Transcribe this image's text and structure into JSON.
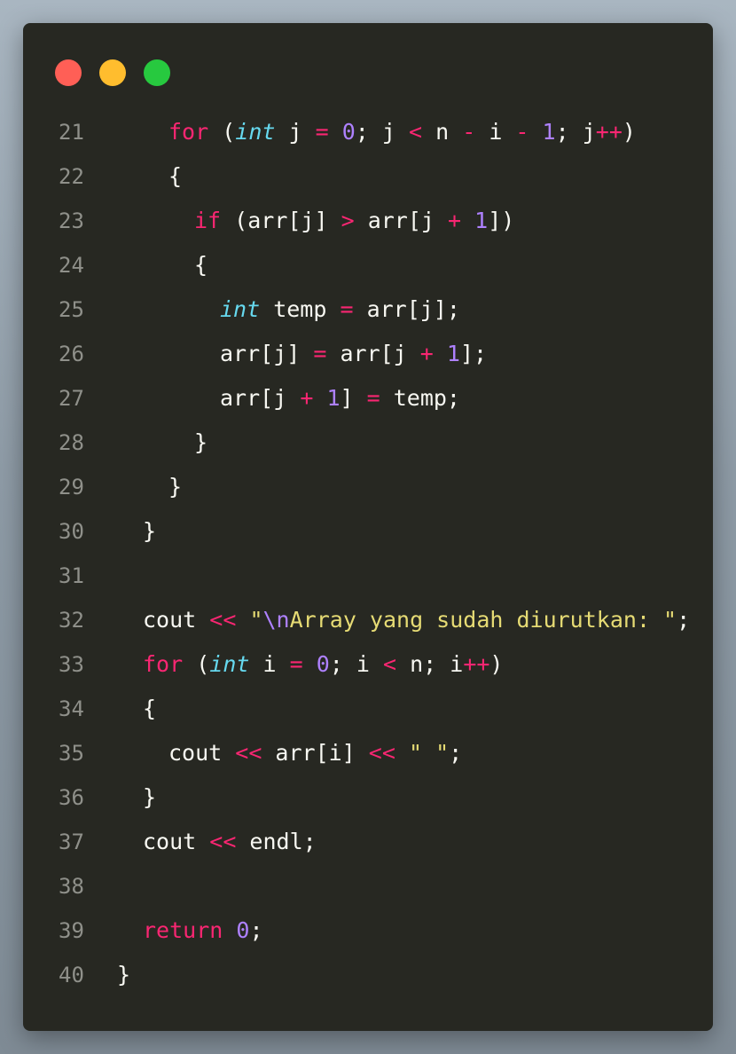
{
  "window": {
    "controls": [
      {
        "name": "close",
        "color": "#ff5f56"
      },
      {
        "name": "minimize",
        "color": "#ffbd2e"
      },
      {
        "name": "maximize",
        "color": "#27c93f"
      }
    ]
  },
  "colors": {
    "background": "#272822",
    "keyword": "#f92672",
    "type": "#66d9ef",
    "number": "#ae81ff",
    "string": "#e6db74",
    "plain": "#f8f8f2",
    "line_number": "#8f908a"
  },
  "code": {
    "lines": [
      {
        "n": "21",
        "indent": 2,
        "tokens": [
          [
            "kw",
            "for"
          ],
          [
            "plain",
            " ("
          ],
          [
            "type",
            "int"
          ],
          [
            "plain",
            " j "
          ],
          [
            "op",
            "="
          ],
          [
            "plain",
            " "
          ],
          [
            "num",
            "0"
          ],
          [
            "plain",
            "; j "
          ],
          [
            "op",
            "<"
          ],
          [
            "plain",
            " n "
          ],
          [
            "op",
            "-"
          ],
          [
            "plain",
            " i "
          ],
          [
            "op",
            "-"
          ],
          [
            "plain",
            " "
          ],
          [
            "num",
            "1"
          ],
          [
            "plain",
            "; j"
          ],
          [
            "op",
            "++"
          ],
          [
            "plain",
            ")"
          ]
        ]
      },
      {
        "n": "22",
        "indent": 2,
        "tokens": [
          [
            "plain",
            "{"
          ]
        ]
      },
      {
        "n": "23",
        "indent": 3,
        "tokens": [
          [
            "kw",
            "if"
          ],
          [
            "plain",
            " (arr[j] "
          ],
          [
            "op",
            ">"
          ],
          [
            "plain",
            " arr[j "
          ],
          [
            "op",
            "+"
          ],
          [
            "plain",
            " "
          ],
          [
            "num",
            "1"
          ],
          [
            "plain",
            "])"
          ]
        ]
      },
      {
        "n": "24",
        "indent": 3,
        "tokens": [
          [
            "plain",
            "{"
          ]
        ]
      },
      {
        "n": "25",
        "indent": 4,
        "tokens": [
          [
            "type",
            "int"
          ],
          [
            "plain",
            " temp "
          ],
          [
            "op",
            "="
          ],
          [
            "plain",
            " arr[j];"
          ]
        ]
      },
      {
        "n": "26",
        "indent": 4,
        "tokens": [
          [
            "plain",
            "arr[j] "
          ],
          [
            "op",
            "="
          ],
          [
            "plain",
            " arr[j "
          ],
          [
            "op",
            "+"
          ],
          [
            "plain",
            " "
          ],
          [
            "num",
            "1"
          ],
          [
            "plain",
            "];"
          ]
        ]
      },
      {
        "n": "27",
        "indent": 4,
        "tokens": [
          [
            "plain",
            "arr[j "
          ],
          [
            "op",
            "+"
          ],
          [
            "plain",
            " "
          ],
          [
            "num",
            "1"
          ],
          [
            "plain",
            "] "
          ],
          [
            "op",
            "="
          ],
          [
            "plain",
            " temp;"
          ]
        ]
      },
      {
        "n": "28",
        "indent": 3,
        "tokens": [
          [
            "plain",
            "}"
          ]
        ]
      },
      {
        "n": "29",
        "indent": 2,
        "tokens": [
          [
            "plain",
            "}"
          ]
        ]
      },
      {
        "n": "30",
        "indent": 1,
        "tokens": [
          [
            "plain",
            "}"
          ]
        ]
      },
      {
        "n": "31",
        "indent": 0,
        "tokens": []
      },
      {
        "n": "32",
        "indent": 1,
        "tokens": [
          [
            "plain",
            "cout "
          ],
          [
            "op",
            "<<"
          ],
          [
            "plain",
            " "
          ],
          [
            "str",
            "\""
          ],
          [
            "esc",
            "\\n"
          ],
          [
            "str",
            "Array yang sudah diurutkan: "
          ],
          [
            "str",
            "\""
          ],
          [
            "plain",
            ";"
          ]
        ]
      },
      {
        "n": "33",
        "indent": 1,
        "tokens": [
          [
            "kw",
            "for"
          ],
          [
            "plain",
            " ("
          ],
          [
            "type",
            "int"
          ],
          [
            "plain",
            " i "
          ],
          [
            "op",
            "="
          ],
          [
            "plain",
            " "
          ],
          [
            "num",
            "0"
          ],
          [
            "plain",
            "; i "
          ],
          [
            "op",
            "<"
          ],
          [
            "plain",
            " n; i"
          ],
          [
            "op",
            "++"
          ],
          [
            "plain",
            ")"
          ]
        ]
      },
      {
        "n": "34",
        "indent": 1,
        "tokens": [
          [
            "plain",
            "{"
          ]
        ]
      },
      {
        "n": "35",
        "indent": 2,
        "tokens": [
          [
            "plain",
            "cout "
          ],
          [
            "op",
            "<<"
          ],
          [
            "plain",
            " arr[i] "
          ],
          [
            "op",
            "<<"
          ],
          [
            "plain",
            " "
          ],
          [
            "str",
            "\" \""
          ],
          [
            "plain",
            ";"
          ]
        ]
      },
      {
        "n": "36",
        "indent": 1,
        "tokens": [
          [
            "plain",
            "}"
          ]
        ]
      },
      {
        "n": "37",
        "indent": 1,
        "tokens": [
          [
            "plain",
            "cout "
          ],
          [
            "op",
            "<<"
          ],
          [
            "plain",
            " endl;"
          ]
        ]
      },
      {
        "n": "38",
        "indent": 0,
        "tokens": []
      },
      {
        "n": "39",
        "indent": 1,
        "tokens": [
          [
            "kw",
            "return"
          ],
          [
            "plain",
            " "
          ],
          [
            "num",
            "0"
          ],
          [
            "plain",
            ";"
          ]
        ]
      },
      {
        "n": "40",
        "indent": 0,
        "tokens": [
          [
            "plain",
            "}"
          ]
        ]
      }
    ]
  }
}
